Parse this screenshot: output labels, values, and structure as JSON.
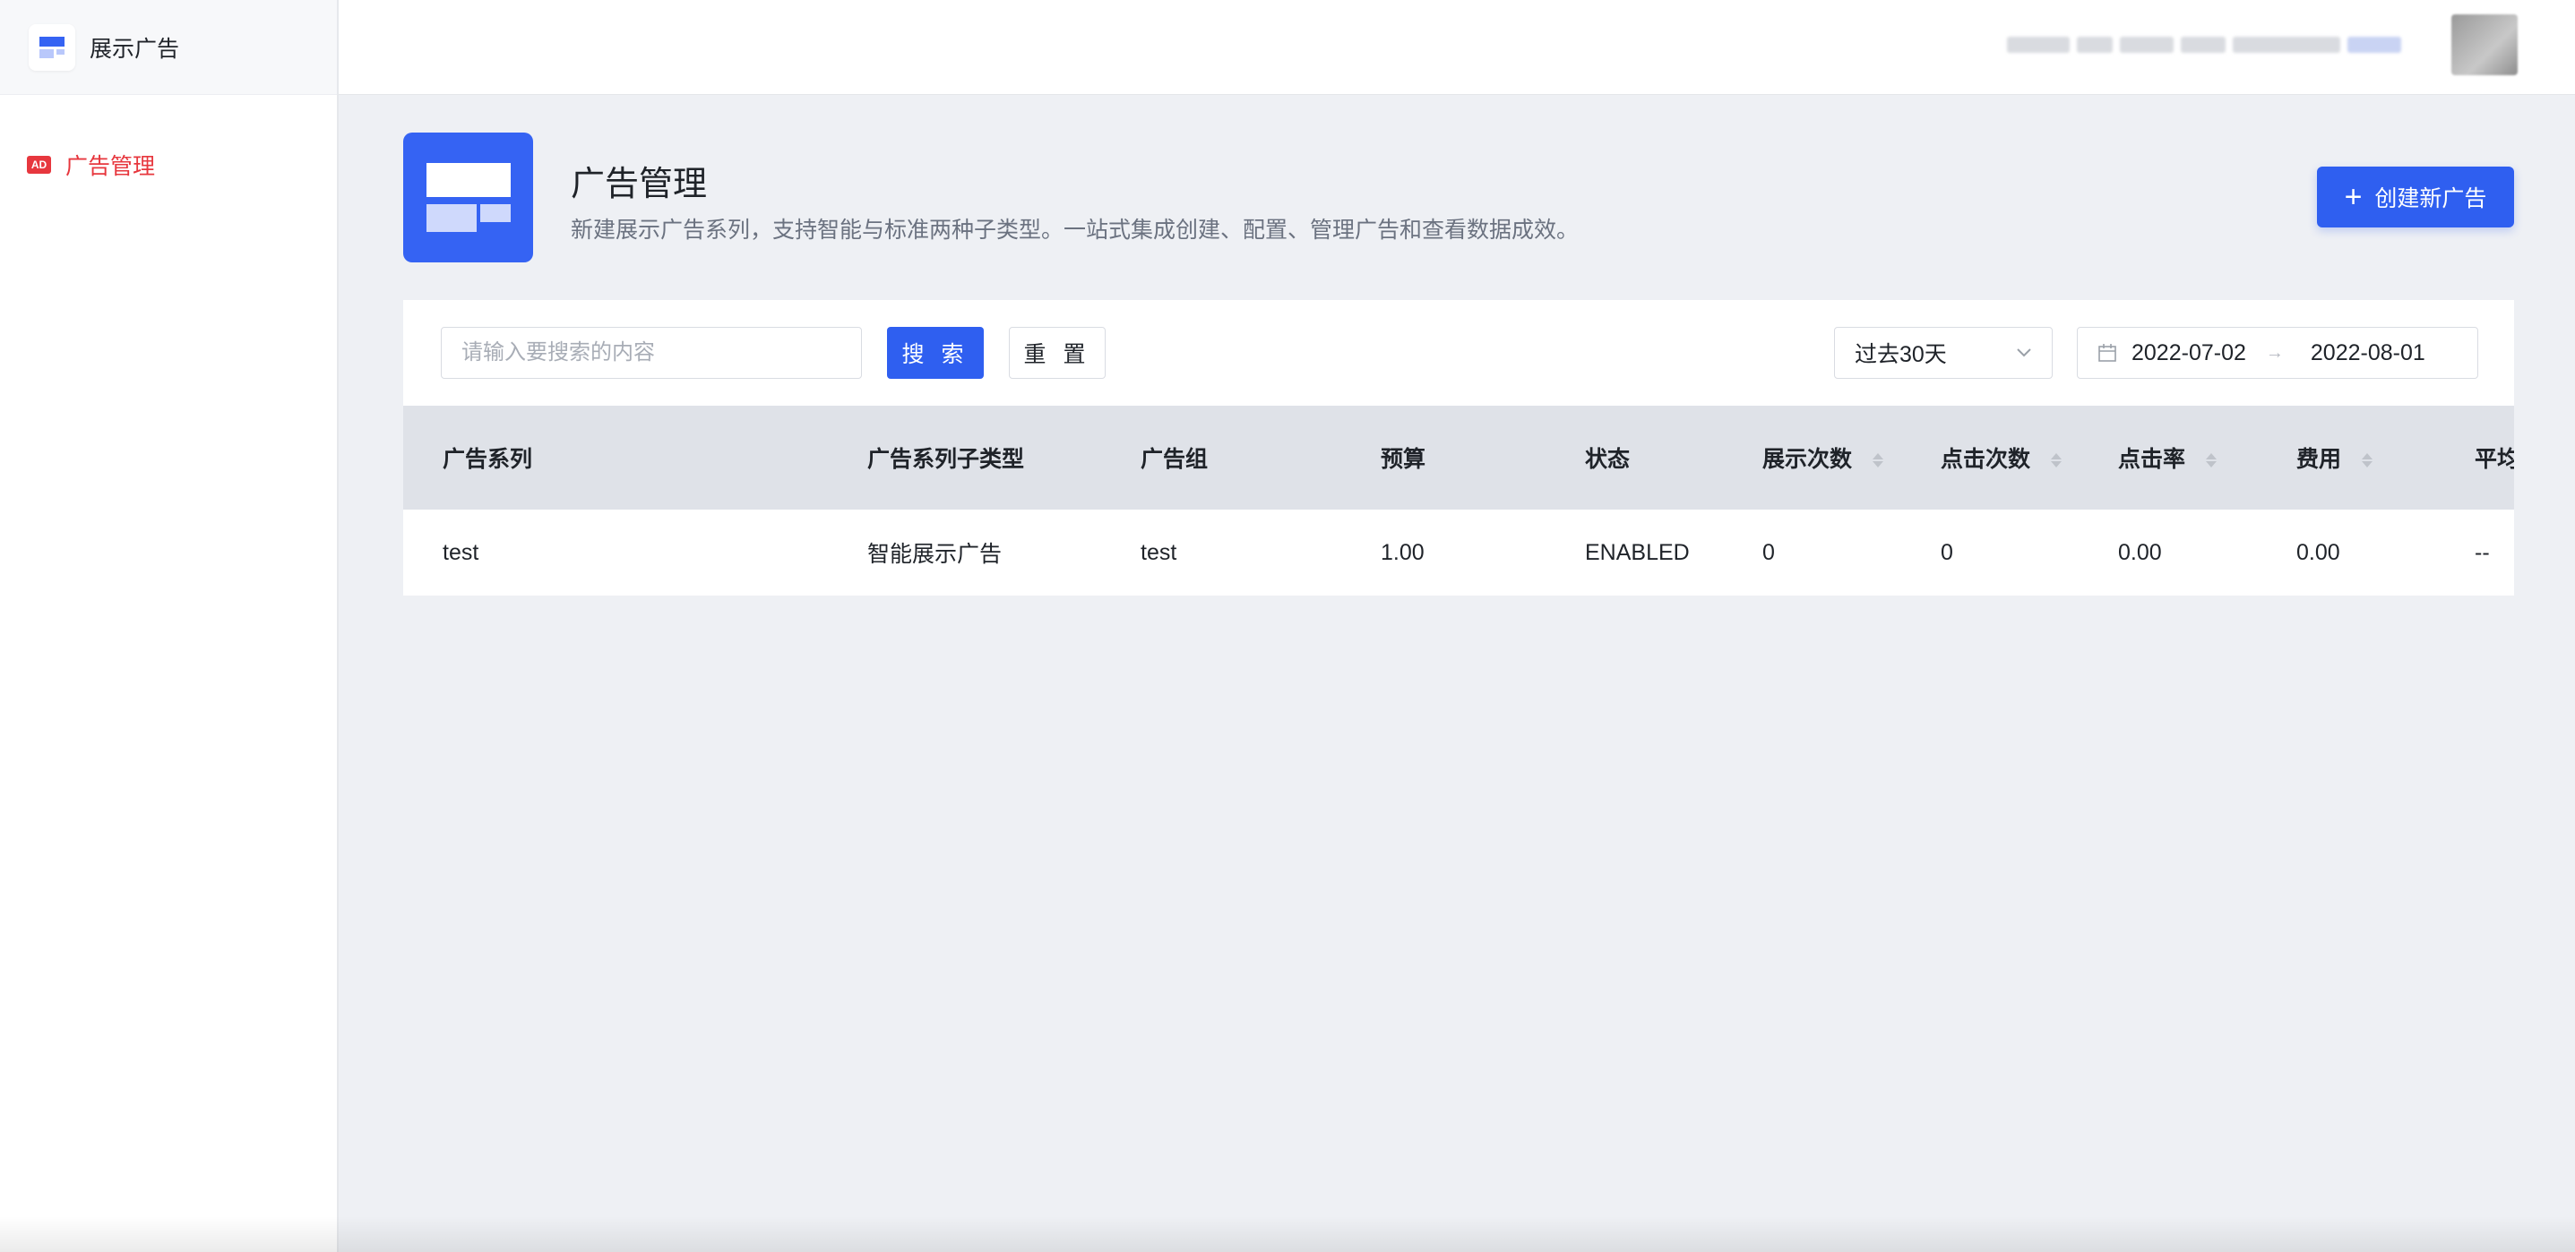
{
  "app": {
    "brand_title": "展示广告"
  },
  "sidebar": {
    "items": [
      {
        "badge": "AD",
        "label": "广告管理"
      }
    ]
  },
  "header": {
    "title": "广告管理",
    "description": "新建展示广告系列，支持智能与标准两种子类型。一站式集成创建、配置、管理广告和查看数据成效。",
    "create_button": "创建新广告"
  },
  "filters": {
    "search_placeholder": "请输入要搜索的内容",
    "search_button": "搜 索",
    "reset_button": "重 置",
    "period": "过去30天",
    "date_start": "2022-07-02",
    "date_end": "2022-08-01"
  },
  "table": {
    "columns": [
      "广告系列",
      "广告系列子类型",
      "广告组",
      "预算",
      "状态",
      "展示次数",
      "点击次数",
      "点击率",
      "费用",
      "平均"
    ],
    "rows": [
      [
        "test",
        "智能展示广告",
        "test",
        "1.00",
        "ENABLED",
        "0",
        "0",
        "0.00",
        "0.00",
        "--"
      ]
    ]
  },
  "colors": {
    "primary": "#2f5ff0",
    "active_menu": "#e7373e",
    "background": "#eef0f4"
  }
}
